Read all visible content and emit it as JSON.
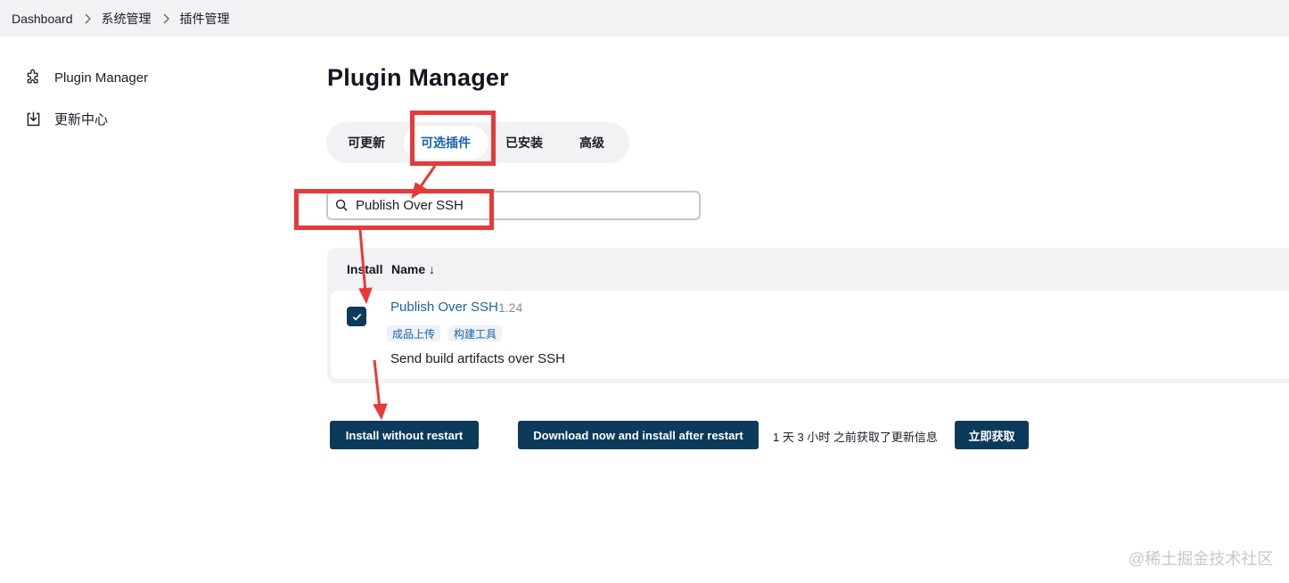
{
  "breadcrumb": {
    "items": [
      "Dashboard",
      "系统管理",
      "插件管理"
    ]
  },
  "sidebar": {
    "items": [
      {
        "label": "Plugin Manager",
        "icon": "puzzle-icon"
      },
      {
        "label": "更新中心",
        "icon": "download-icon"
      }
    ]
  },
  "main": {
    "title": "Plugin Manager",
    "tabs": [
      {
        "label": "可更新",
        "active": false
      },
      {
        "label": "可选插件",
        "active": true
      },
      {
        "label": "已安装",
        "active": false
      },
      {
        "label": "高级",
        "active": false
      }
    ],
    "search": {
      "value": "Publish Over SSH"
    },
    "table": {
      "headers": {
        "install": "Install",
        "name": "Name ↓"
      },
      "rows": [
        {
          "checked": true,
          "name": "Publish Over SSH",
          "version": "1.24",
          "tags": [
            "成品上传",
            "构建工具"
          ],
          "description": "Send build artifacts over SSH"
        }
      ]
    },
    "buttons": {
      "install": "Install without restart",
      "download": "Download now and install after restart",
      "fetch": "立即获取"
    },
    "update_info": "1 天 3 小时 之前获取了更新信息"
  },
  "watermark": "@稀土掘金技术社区",
  "colors": {
    "accent": "#1a63a6",
    "button": "#0b3a5a",
    "annotation": "#e63a3a",
    "panel": "#f2f2f5"
  }
}
